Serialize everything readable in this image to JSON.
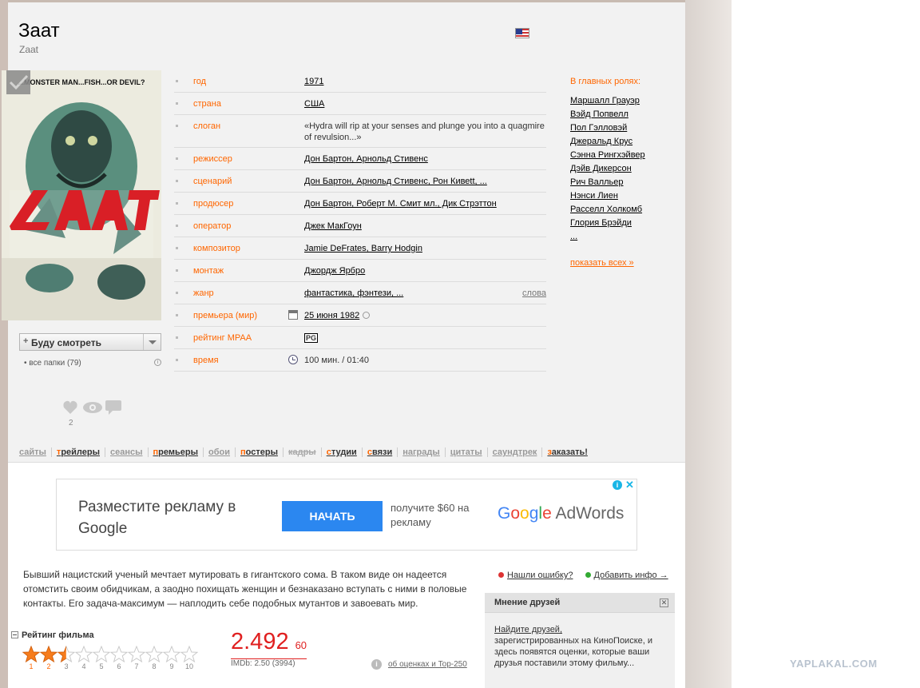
{
  "film": {
    "title": "Заат",
    "original_title": "Zaat"
  },
  "poster": {
    "tagline": "...MONSTER MAN...FISH...OR DEVIL?",
    "logo_text": "ZAAT"
  },
  "info_rows": [
    {
      "key": "год",
      "value": "1971"
    },
    {
      "key": "страна",
      "value": "США"
    },
    {
      "key": "слоган",
      "value": "«Hydra will rip at your senses and plunge you into a quagmire of revulsion...»"
    },
    {
      "key": "режиссер",
      "value": "Дон Бартон, Арнольд Стивенс"
    },
    {
      "key": "сценарий",
      "value": "Дон Бартон, Арнольд Стивенс, Рон Кивеtt, ..."
    },
    {
      "key": "продюсер",
      "value": "Дон Бартон, Роберт М. Смит мл., Дик Стрэттон"
    },
    {
      "key": "оператор",
      "value": "Джек МакГоун"
    },
    {
      "key": "композитор",
      "value": "Jamie DeFrates, Barry Hodgin"
    },
    {
      "key": "монтаж",
      "value": "Джордж Ярбро"
    },
    {
      "key": "жанр",
      "value": "фантастика, фэнтези, ...",
      "extra": "слова"
    },
    {
      "key": "премьера (мир)",
      "value": "25 июня 1982"
    },
    {
      "key": "рейтинг MPAA",
      "value": "PG"
    },
    {
      "key": "время",
      "value": "100 мин. / 01:40"
    }
  ],
  "cast": {
    "heading": "В главных ролях:",
    "actors": [
      "Маршалл Грауэр",
      "Вэйд Попвелл",
      "Пол Гэлловэй",
      "Джеральд Крус",
      "Сэнна Рингхэйвер",
      "Дэйв Дикерсон",
      "Рич Валльер",
      "Нэнси Лиен",
      "Расселл Холкомб",
      "Глория Брэйди",
      "..."
    ],
    "show_all": "показать всех »"
  },
  "watch": {
    "button": "Буду смотреть",
    "folders": "все папки (79)"
  },
  "social": {
    "likes": "2"
  },
  "tabs": [
    {
      "label": "сайты",
      "state": "normal"
    },
    {
      "label": "трейлеры",
      "state": "active"
    },
    {
      "label": "сеансы",
      "state": "normal"
    },
    {
      "label": "премьеры",
      "state": "active"
    },
    {
      "label": "обои",
      "state": "normal"
    },
    {
      "label": "постеры",
      "state": "active"
    },
    {
      "label": "кадры",
      "state": "disabled"
    },
    {
      "label": "студии",
      "state": "active"
    },
    {
      "label": "связи",
      "state": "active"
    },
    {
      "label": "награды",
      "state": "normal"
    },
    {
      "label": "цитаты",
      "state": "normal"
    },
    {
      "label": "саундтрек",
      "state": "normal"
    },
    {
      "label": "заказать!",
      "state": "active"
    }
  ],
  "ad": {
    "headline": "Разместите рекламу в Google",
    "button": "НАЧАТЬ",
    "offer": "получите $60 на рекламу",
    "brand": "Google AdWords"
  },
  "description": "Бывший нацистский ученый мечтает мутировать в гигантского сома. В таком виде он надеется отомстить своим обидчикам, а заодно похищать женщин и безнаказано вступать с ними в половые контакты. Его задача-максимум — наплодить себе подобных мутантов и завоевать мир.",
  "actions": {
    "report": "Нашли ошибку?",
    "add_info": "Добавить инфо →"
  },
  "friends": {
    "heading": "Мнение друзей",
    "link": "Найдите друзей,",
    "text": "зарегистрированных на КиноПоиске, и здесь появятся оценки, которые ваши друзья поставили этому фильму..."
  },
  "rating": {
    "heading": "Рейтинг фильма",
    "value": "2.492",
    "votes": "60",
    "imdb": "IMDb: 2.50 (3994)",
    "about": "об оценках и Top-250",
    "stars_max": 10,
    "stars_value": 2.492,
    "star_labels": [
      "1",
      "2",
      "3",
      "4",
      "5",
      "6",
      "7",
      "8",
      "9",
      "10"
    ]
  },
  "watermark": "YAPLAKAL.COM",
  "colors": {
    "accent": "#ff6600",
    "rating": "#e02020",
    "ad_button": "#2b87f0"
  }
}
